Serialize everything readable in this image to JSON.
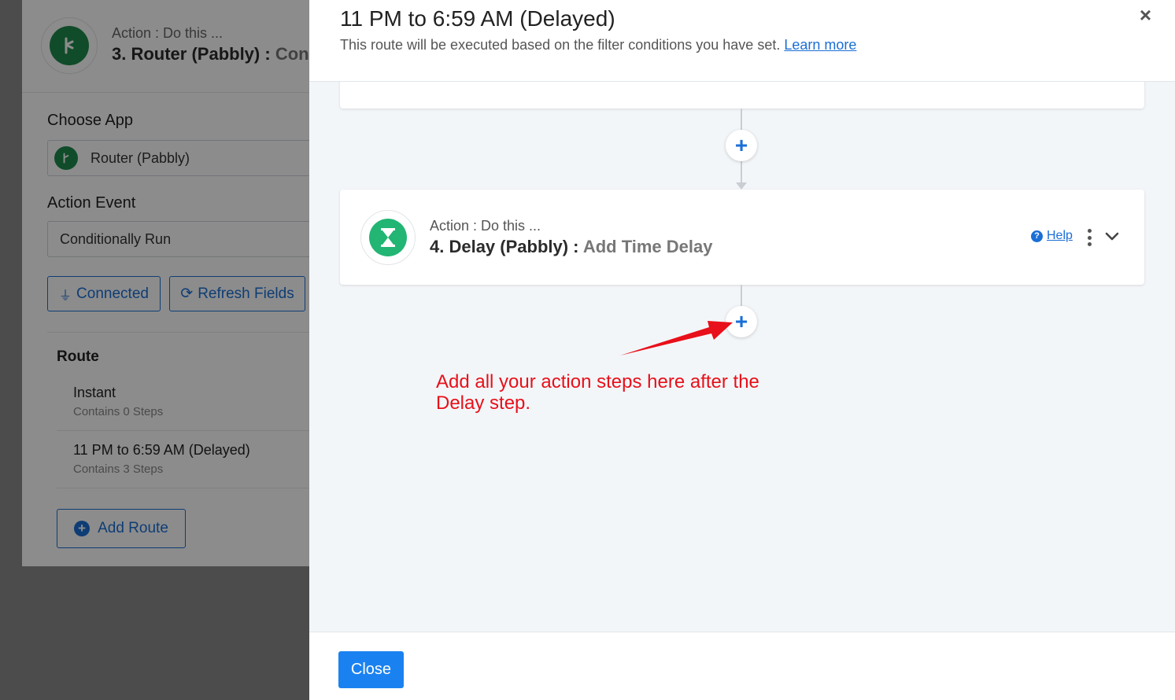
{
  "background": {
    "action_prefix": "Action : Do this ...",
    "action_title": "3. Router (Pabbly) :",
    "action_event_short": "Cond",
    "choose_app_label": "Choose App",
    "choose_app_value": "Router (Pabbly)",
    "action_event_label": "Action Event",
    "action_event_value": "Conditionally Run",
    "connected_button": "Connected",
    "refresh_button": "Refresh Fields",
    "route_heading": "Route",
    "routes": [
      {
        "name": "Instant",
        "steps": "Contains 0 Steps"
      },
      {
        "name": "11 PM to 6:59 AM (Delayed)",
        "steps": "Contains 3 Steps"
      }
    ],
    "add_route_button": "Add Route",
    "icons": {
      "app": "router-icon",
      "plug": "plug-icon",
      "refresh": "refresh-icon",
      "add": "plus-circle-icon"
    }
  },
  "modal": {
    "title": "11 PM to 6:59 AM (Delayed)",
    "subtitle": "This route will be executed based on the filter conditions you have set.",
    "learn_more": "Learn more",
    "close_icon": "×",
    "step": {
      "action_prefix": "Action : Do this ...",
      "title": "4. Delay (Pabbly) :",
      "subtitle": "Add Time Delay",
      "help_label": "Help",
      "icon": "hourglass-icon"
    },
    "plus_symbol": "+",
    "annotation": "Add all your action steps here after the Delay step.",
    "footer_close": "Close"
  },
  "colors": {
    "accent": "#1a6fd6",
    "primary_button": "#1a82f0",
    "router_green": "#1e8a4c",
    "delay_green": "#22b573",
    "annotation_red": "#e8101a"
  }
}
